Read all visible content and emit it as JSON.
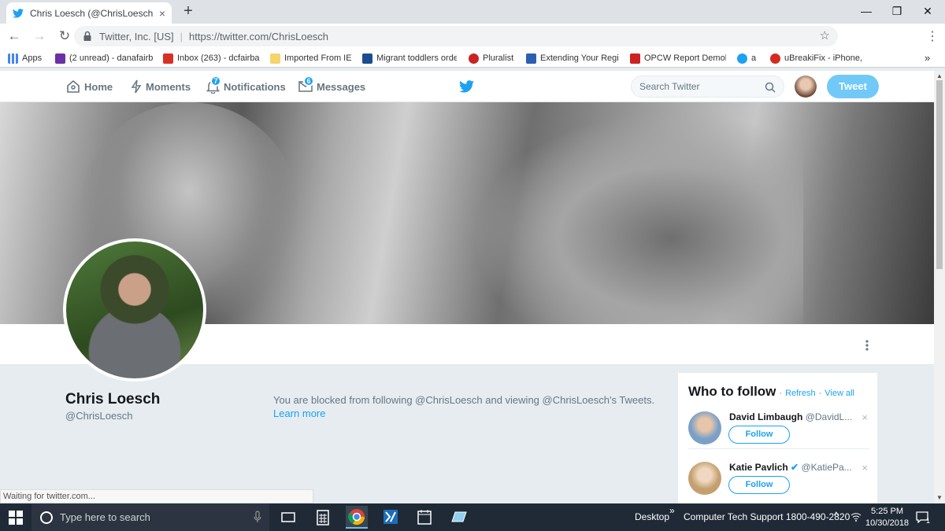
{
  "browser": {
    "tab_title": "Chris Loesch (@ChrisLoesch) | Tw",
    "tab_close": "×",
    "new_tab": "+",
    "window_controls": {
      "minimize": "—",
      "maximize": "❐",
      "close": "✕"
    },
    "nav": {
      "back": "←",
      "forward": "→",
      "reload": "↻"
    },
    "omnibox_org": "Twitter, Inc. [US]",
    "omnibox_url": "https://twitter.com/ChrisLoesch",
    "star": "☆",
    "menu": "⋮",
    "bookmarks": [
      {
        "label": "Apps",
        "color": "#4285f4"
      },
      {
        "label": "(2 unread) - danafairb",
        "color": "#6b2fa8"
      },
      {
        "label": "Inbox (263) - dcfairba",
        "color": "#d93025"
      },
      {
        "label": "Imported From IE",
        "color": "#f6d36b"
      },
      {
        "label": "Migrant toddlers orde",
        "color": "#1a4d8f"
      },
      {
        "label": "Pluralist",
        "color": "#c22"
      },
      {
        "label": "Extending Your Regis",
        "color": "#2b5fb0"
      },
      {
        "label": "OPCW Report Demoli",
        "color": "#cc2222"
      },
      {
        "label": "a",
        "color": "#1da1f2"
      },
      {
        "label": "uBreakiFix - iPhone, S",
        "color": "#d52b1e"
      }
    ],
    "bookmarks_more": "»"
  },
  "twitter": {
    "nav": {
      "home": "Home",
      "moments": "Moments",
      "notifications": "Notifications",
      "notifications_count": "7",
      "messages": "Messages",
      "messages_count": "6"
    },
    "search_placeholder": "Search Twitter",
    "tweet_button": "Tweet",
    "accent": "#1da1f2",
    "profile": {
      "name": "Chris Loesch",
      "handle": "@ChrisLoesch",
      "blocked_text": "You are blocked from following @ChrisLoesch and viewing @ChrisLoesch's Tweets.",
      "learn_more": "Learn more"
    },
    "who_to_follow": {
      "title": "Who to follow",
      "dot": "·",
      "refresh": "Refresh",
      "view_all": "View all",
      "suggestions": [
        {
          "name": "David Limbaugh",
          "handle": "@DavidL...",
          "follow": "Follow",
          "dismiss": "×"
        },
        {
          "name": "Katie Pavlich",
          "verified": "✔",
          "handle": "@KatiePa...",
          "follow": "Follow",
          "dismiss": "×"
        }
      ]
    }
  },
  "status_bar": "Waiting for twitter.com...",
  "taskbar": {
    "search_placeholder": "Type here to search",
    "desktop_label": "Desktop",
    "chevron": "»",
    "toolbar_text": "Computer Tech Support  1800-490-2820",
    "up_arrow": "^",
    "time": "5:25 PM",
    "date": "10/30/2018",
    "notification_count": "1"
  }
}
